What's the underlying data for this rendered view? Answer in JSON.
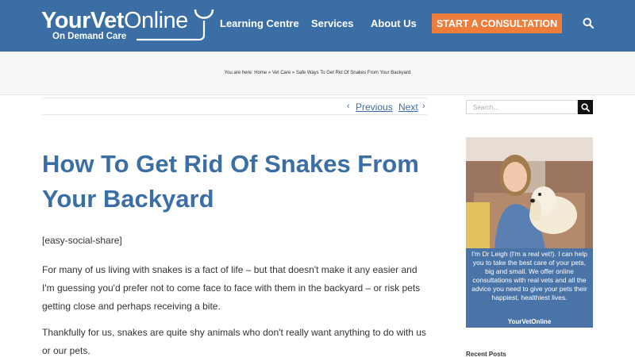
{
  "header": {
    "logo_your": "Your",
    "logo_vet": "Vet",
    "logo_online": "Online",
    "logo_tagline": "On Demand Care",
    "nav": [
      "Learning Centre",
      "Services",
      "About Us"
    ],
    "cta_label": "START A CONSULTATION",
    "search_icon": "search-icon"
  },
  "breadcrumb": {
    "text": "You are here: Home » Vet Care » Safe Ways To Get Rid Of Snakes From Your Backyard"
  },
  "post_nav": {
    "previous_label": "Previous",
    "next_label": "Next"
  },
  "article": {
    "title": "How To Get Rid Of Snakes From Your Backyard",
    "shortcode": "[easy-social-share]",
    "paragraphs": [
      "For many of us living with snakes is a fact of life – but that doesn't make it any easier and I'm guessing you'd prefer not to come face to face with them in the backyard – or risk pets getting close and perhaps receiving a bite.",
      "Thankfully for us, snakes are quite shy animals who don't really want anything to do with us or our pets."
    ]
  },
  "sidebar": {
    "search_placeholder": "Search...",
    "promo_text": "I'm Dr Leigh (I'm a real vet!). I can help you to take the best care of your pets, big and small. We offer online consultations with real vets and all the advice you need to give your pets their happiest, healthiest lives.",
    "promo_brand": "YourVetOnline",
    "recent_posts_heading": "Recent Posts"
  },
  "colors": {
    "header_blue": "#3a6ea5",
    "cta_orange": "#ee7d3b",
    "title_blue": "#3a6ea5"
  }
}
